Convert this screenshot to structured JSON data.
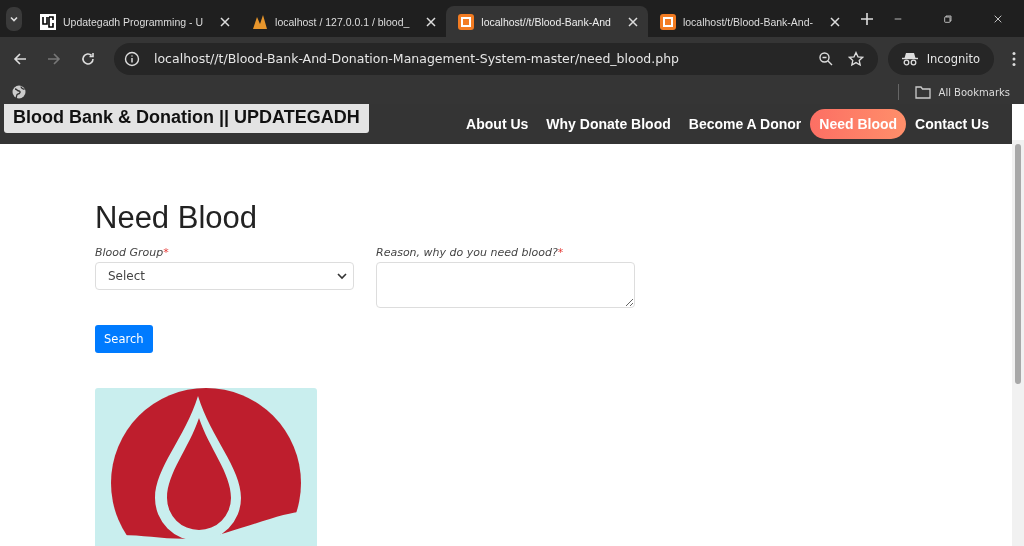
{
  "browser": {
    "tabs": [
      {
        "title": "Updategadh Programming - U",
        "kind": "ug",
        "selected": false
      },
      {
        "title": "localhost / 127.0.0.1 / blood_",
        "kind": "pma",
        "selected": false
      },
      {
        "title": "localhost//t/Blood-Bank-And",
        "kind": "xampp",
        "selected": true
      },
      {
        "title": "localhost/t/Blood-Bank-And-",
        "kind": "xampp",
        "selected": false
      }
    ],
    "address": "localhost//t/Blood-Bank-And-Donation-Management-System-master/need_blood.php",
    "profile": "Incognito",
    "bookmarks": "All Bookmarks"
  },
  "navbar": {
    "brand": "Blood Bank & Donation || UPDATEGADH",
    "items": [
      {
        "label": "About Us",
        "selected": false
      },
      {
        "label": "Why Donate Blood",
        "selected": false
      },
      {
        "label": "Become A Donor",
        "selected": false
      },
      {
        "label": "Need Blood",
        "selected": true
      },
      {
        "label": "Contact Us",
        "selected": false
      }
    ]
  },
  "page": {
    "heading": "Need Blood",
    "fields": [
      {
        "kind": "select",
        "label": "Blood Group",
        "required_mark": "*",
        "value": "Select"
      },
      {
        "kind": "textarea",
        "label": "Reason, why do you need blood?",
        "required_mark": "*"
      }
    ],
    "button": "Search"
  }
}
